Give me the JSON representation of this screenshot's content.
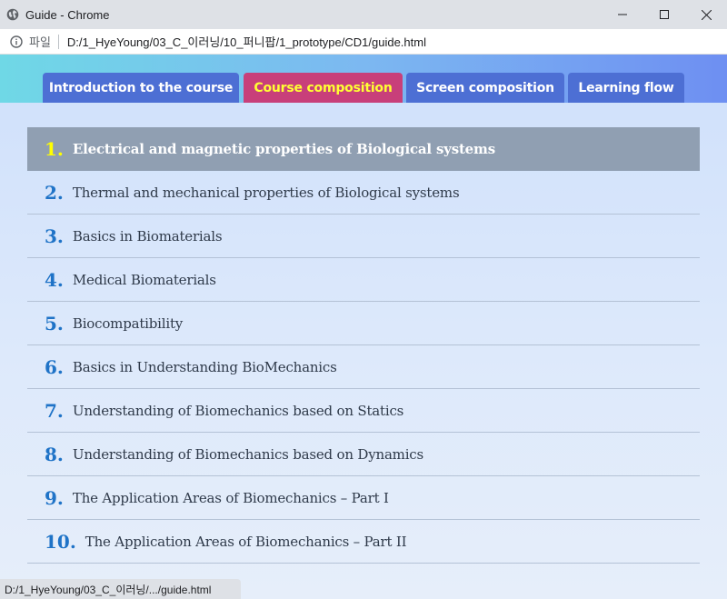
{
  "window": {
    "title": "Guide - Chrome",
    "controls": [
      "minimize",
      "maximize",
      "close"
    ]
  },
  "address": {
    "scheme_label": "파일",
    "url": "D:/1_HyeYoung/03_C_이러닝/10_퍼니팝/1_prototype/CD1/guide.html"
  },
  "tabs": [
    {
      "label": "Introduction to the course",
      "active": false
    },
    {
      "label": "Course composition",
      "active": true
    },
    {
      "label": "Screen composition",
      "active": false
    },
    {
      "label": "Learning flow",
      "active": false
    }
  ],
  "colors": {
    "tab_default": "#4d6fd4",
    "tab_active": "#c83f7a",
    "tab_active_text": "#ffff33",
    "number": "#1f73c7",
    "selected_row": "#909fb2"
  },
  "courses": [
    {
      "num": "1.",
      "label": "Electrical and magnetic properties of Biological systems",
      "selected": true
    },
    {
      "num": "2.",
      "label": "Thermal and mechanical properties of Biological systems",
      "selected": false
    },
    {
      "num": "3.",
      "label": "Basics in Biomaterials",
      "selected": false
    },
    {
      "num": "4.",
      "label": "Medical Biomaterials",
      "selected": false
    },
    {
      "num": "5.",
      "label": "Biocompatibility",
      "selected": false
    },
    {
      "num": "6.",
      "label": "Basics in Understanding BioMechanics",
      "selected": false
    },
    {
      "num": "7.",
      "label": "Understanding of Biomechanics based on Statics",
      "selected": false
    },
    {
      "num": "8.",
      "label": "Understanding of Biomechanics based on Dynamics",
      "selected": false
    },
    {
      "num": "9.",
      "label": "The Application Areas of Biomechanics – Part I",
      "selected": false
    },
    {
      "num": "10.",
      "label": "The Application Areas of Biomechanics – Part II",
      "selected": false
    }
  ],
  "status_bar": {
    "text": "D:/1_HyeYoung/03_C_이러닝/.../guide.html"
  }
}
